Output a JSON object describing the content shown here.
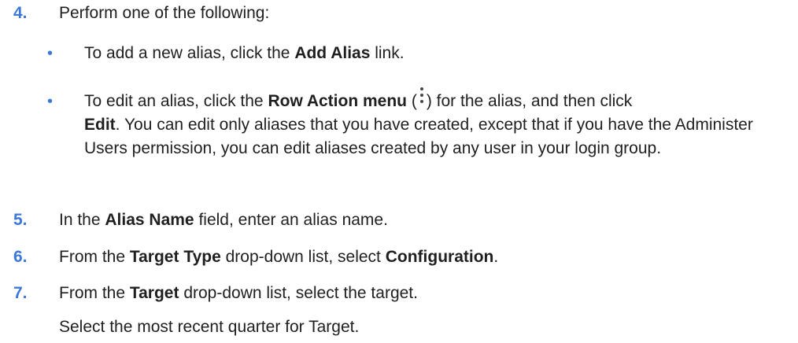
{
  "steps": [
    {
      "num": "4.",
      "text": "Perform one of the following:",
      "bullets": [
        {
          "marker": "•",
          "pre": "To add a new alias, click the ",
          "bold1": "Add Alias",
          "post": " link."
        },
        {
          "marker": "•",
          "pre": "To edit an alias, click the ",
          "bold1": "Row Action menu",
          "paren_open": " (",
          "icon": "kebab-menu-icon",
          "paren_close": ") for the alias, and then click",
          "bold2": "Edit",
          "post": ". You can edit only aliases that you have created, except that if you have the Administer Users permission, you can edit aliases created by any user in your login group."
        }
      ]
    },
    {
      "num": "5.",
      "pre": "In the ",
      "bold1": "Alias Name",
      "post": " field, enter an alias name."
    },
    {
      "num": "6.",
      "pre": "From the ",
      "bold1": "Target Type",
      "mid": " drop-down list, select ",
      "bold2": "Configuration",
      "post": "."
    },
    {
      "num": "7.",
      "pre": "From the ",
      "bold1": "Target",
      "post": " drop-down list, select the target.",
      "note": "Select the most recent quarter for Target."
    }
  ]
}
